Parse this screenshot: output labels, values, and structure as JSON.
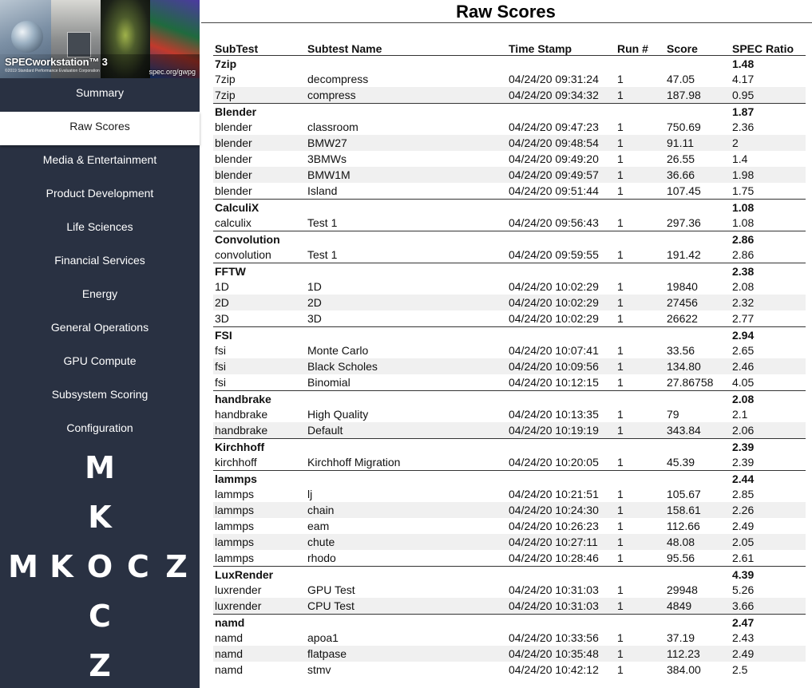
{
  "sidebar": {
    "banner": {
      "title": "SPECworkstation™ 3",
      "copyright": "©2019 Standard Performance Evaluation Corporation",
      "url": "spec.org/gwpg"
    },
    "nav": [
      "Summary",
      "Raw Scores",
      "Media & Entertainment",
      "Product Development",
      "Life Sciences",
      "Financial Services",
      "Energy",
      "General Operations",
      "GPU Compute",
      "Subsystem Scoring",
      "Configuration"
    ],
    "active_index": 1,
    "logo_letters": [
      "M",
      "K",
      "M",
      "K",
      "O",
      "C",
      "Z",
      "C",
      "Z"
    ]
  },
  "main": {
    "title": "Raw Scores",
    "columns": [
      "SubTest",
      "Subtest Name",
      "Time Stamp",
      "Run #",
      "Score",
      "SPEC Ratio"
    ],
    "groups": [
      {
        "name": "7zip",
        "ratio": "1.48",
        "rows": [
          [
            "7zip",
            "decompress",
            "04/24/20 09:31:24",
            "1",
            "47.05",
            "4.17"
          ],
          [
            "7zip",
            "compress",
            "04/24/20 09:34:32",
            "1",
            "187.98",
            "0.95"
          ]
        ]
      },
      {
        "name": "Blender",
        "ratio": "1.87",
        "rows": [
          [
            "blender",
            "classroom",
            "04/24/20 09:47:23",
            "1",
            "750.69",
            "2.36"
          ],
          [
            "blender",
            "BMW27",
            "04/24/20 09:48:54",
            "1",
            "91.11",
            "2"
          ],
          [
            "blender",
            "3BMWs",
            "04/24/20 09:49:20",
            "1",
            "26.55",
            "1.4"
          ],
          [
            "blender",
            "BMW1M",
            "04/24/20 09:49:57",
            "1",
            "36.66",
            "1.98"
          ],
          [
            "blender",
            "Island",
            "04/24/20 09:51:44",
            "1",
            "107.45",
            "1.75"
          ]
        ]
      },
      {
        "name": "CalculiX",
        "ratio": "1.08",
        "rows": [
          [
            "calculix",
            "Test 1",
            "04/24/20 09:56:43",
            "1",
            "297.36",
            "1.08"
          ]
        ]
      },
      {
        "name": "Convolution",
        "ratio": "2.86",
        "rows": [
          [
            "convolution",
            "Test 1",
            "04/24/20 09:59:55",
            "1",
            "191.42",
            "2.86"
          ]
        ]
      },
      {
        "name": "FFTW",
        "ratio": "2.38",
        "rows": [
          [
            "1D",
            "1D",
            "04/24/20 10:02:29",
            "1",
            "19840",
            "2.08"
          ],
          [
            "2D",
            "2D",
            "04/24/20 10:02:29",
            "1",
            "27456",
            "2.32"
          ],
          [
            "3D",
            "3D",
            "04/24/20 10:02:29",
            "1",
            "26622",
            "2.77"
          ]
        ]
      },
      {
        "name": "FSI",
        "ratio": "2.94",
        "rows": [
          [
            "fsi",
            "Monte Carlo",
            "04/24/20 10:07:41",
            "1",
            "33.56",
            "2.65"
          ],
          [
            "fsi",
            "Black Scholes",
            "04/24/20 10:09:56",
            "1",
            "134.80",
            "2.46"
          ],
          [
            "fsi",
            "Binomial",
            "04/24/20 10:12:15",
            "1",
            "27.86758",
            "4.05"
          ]
        ]
      },
      {
        "name": "handbrake",
        "ratio": "2.08",
        "rows": [
          [
            "handbrake",
            "High Quality",
            "04/24/20 10:13:35",
            "1",
            "79",
            "2.1"
          ],
          [
            "handbrake",
            "Default",
            "04/24/20 10:19:19",
            "1",
            "343.84",
            "2.06"
          ]
        ]
      },
      {
        "name": "Kirchhoff",
        "ratio": "2.39",
        "rows": [
          [
            "kirchhoff",
            "Kirchhoff Migration",
            "04/24/20 10:20:05",
            "1",
            "45.39",
            "2.39"
          ]
        ]
      },
      {
        "name": "lammps",
        "ratio": "2.44",
        "rows": [
          [
            "lammps",
            "lj",
            "04/24/20 10:21:51",
            "1",
            "105.67",
            "2.85"
          ],
          [
            "lammps",
            "chain",
            "04/24/20 10:24:30",
            "1",
            "158.61",
            "2.26"
          ],
          [
            "lammps",
            "eam",
            "04/24/20 10:26:23",
            "1",
            "112.66",
            "2.49"
          ],
          [
            "lammps",
            "chute",
            "04/24/20 10:27:11",
            "1",
            "48.08",
            "2.05"
          ],
          [
            "lammps",
            "rhodo",
            "04/24/20 10:28:46",
            "1",
            "95.56",
            "2.61"
          ]
        ]
      },
      {
        "name": "LuxRender",
        "ratio": "4.39",
        "rows": [
          [
            "luxrender",
            "GPU Test",
            "04/24/20 10:31:03",
            "1",
            "29948",
            "5.26"
          ],
          [
            "luxrender",
            "CPU Test",
            "04/24/20 10:31:03",
            "1",
            "4849",
            "3.66"
          ]
        ]
      },
      {
        "name": "namd",
        "ratio": "2.47",
        "rows": [
          [
            "namd",
            "apoa1",
            "04/24/20 10:33:56",
            "1",
            "37.19",
            "2.43"
          ],
          [
            "namd",
            "flatpase",
            "04/24/20 10:35:48",
            "1",
            "112.23",
            "2.49"
          ],
          [
            "namd",
            "stmv",
            "04/24/20 10:42:12",
            "1",
            "384.00",
            "2.5"
          ]
        ]
      }
    ]
  }
}
